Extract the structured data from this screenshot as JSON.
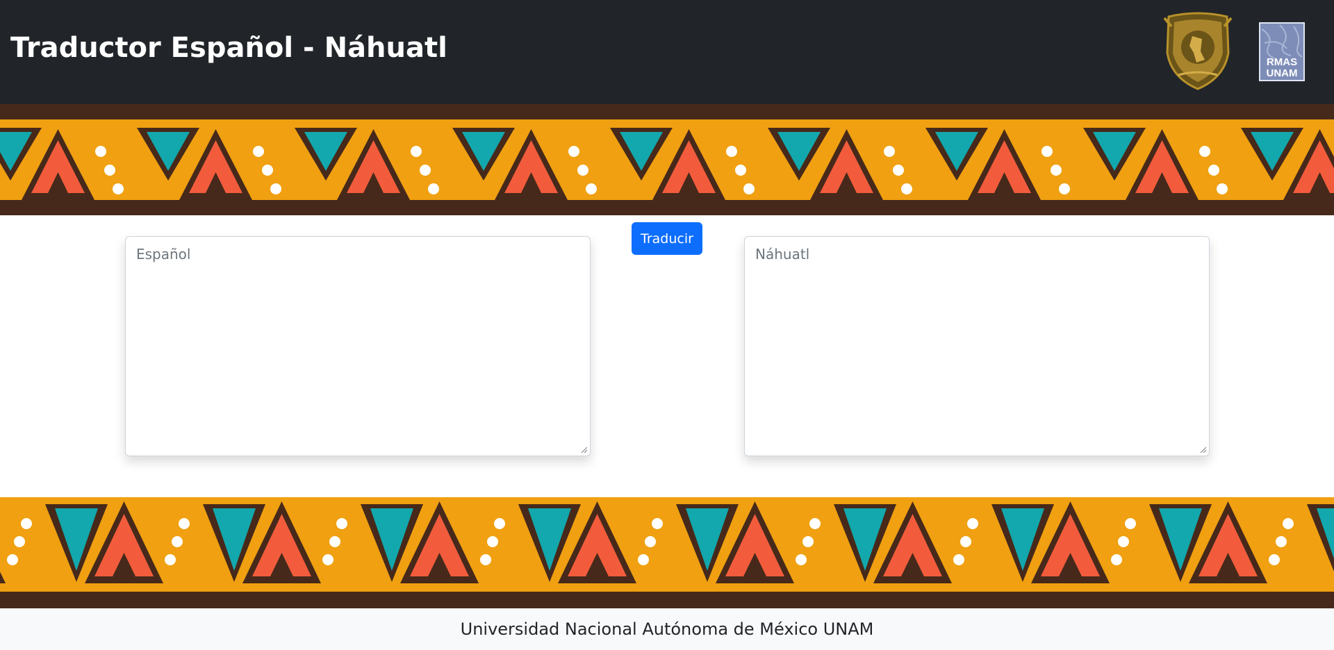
{
  "header": {
    "title": "Traductor Español - Náhuatl",
    "logos": [
      "unam-shield-logo",
      "ermas-unam-logo"
    ],
    "ermas_logo_text": [
      "RMAS",
      "UNAM"
    ]
  },
  "translator": {
    "source_placeholder": "Español",
    "target_placeholder": "Náhuatl",
    "translate_label": "Traducir"
  },
  "footer": {
    "text": "Universidad Nacional Autónoma de México UNAM"
  },
  "colors": {
    "navbar": "#212529",
    "pattern_brown": "#46291a",
    "pattern_orange": "#f0a010",
    "pattern_teal": "#12a8ad",
    "pattern_coral": "#f25c3c",
    "button": "#0d6efd",
    "footer_bg": "#f8f9fa"
  }
}
